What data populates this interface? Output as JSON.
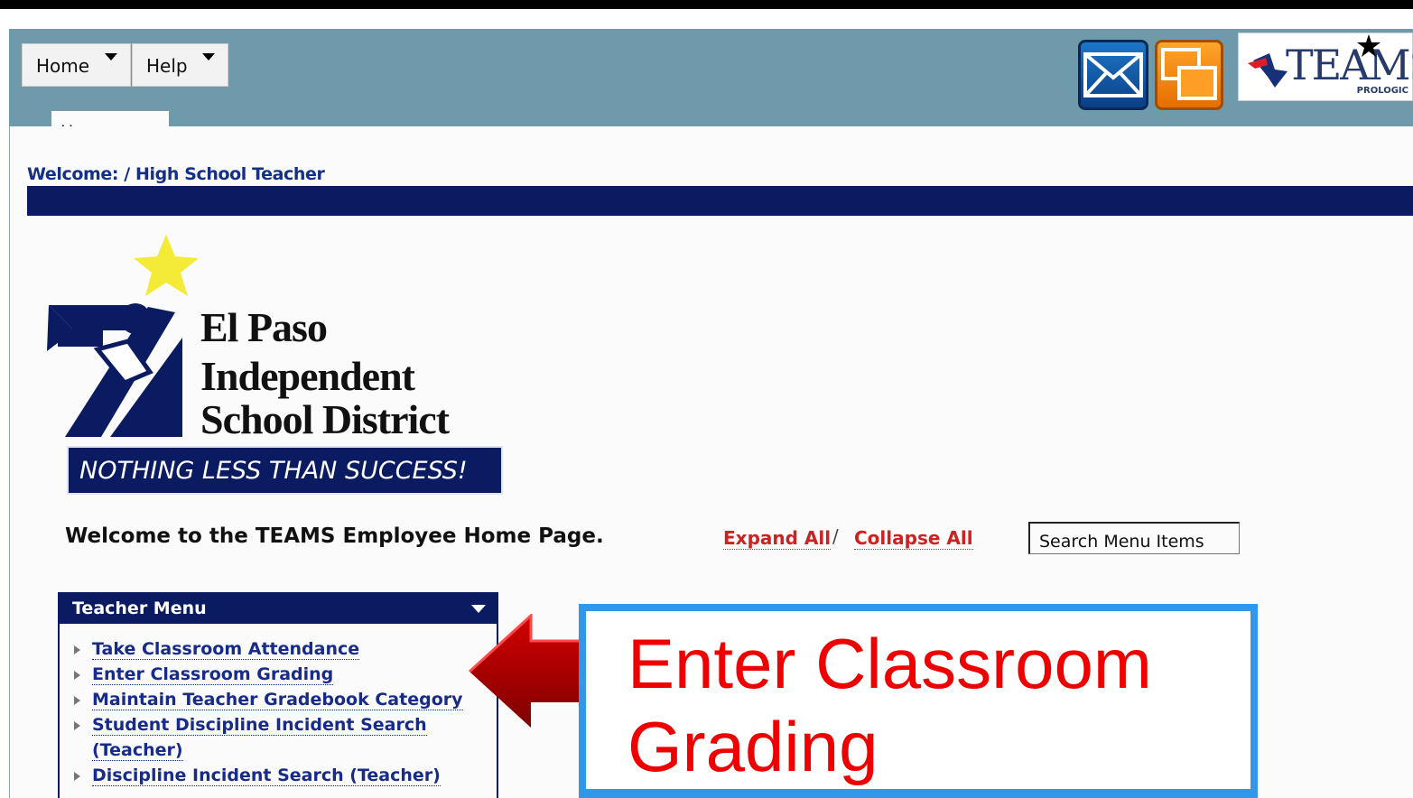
{
  "menubar": {
    "home_label": "Home",
    "help_label": "Help"
  },
  "header": {
    "teams_logo_text": "TEAMS",
    "teams_logo_sub": "PROLOGIC"
  },
  "tabs": [
    {
      "label": "Homepage"
    }
  ],
  "breadcrumb": {
    "text": "Welcome: / High School Teacher"
  },
  "district_logo": {
    "line1": "El Paso",
    "line2": "Independent",
    "line3": "School District",
    "motto": "NOTHING LESS THAN SUCCESS!"
  },
  "home": {
    "welcome_text": "Welcome to the TEAMS Employee Home Page.",
    "expand_all_label": "Expand All",
    "separator": "/",
    "collapse_all_label": "Collapse All",
    "search_value": "Search Menu Items"
  },
  "teacher_menu": {
    "title": "Teacher Menu",
    "items": [
      {
        "label": "Take Classroom Attendance"
      },
      {
        "label": "Enter Classroom Grading"
      },
      {
        "label": "Maintain Teacher Gradebook Category"
      },
      {
        "label": "Student Discipline Incident Search"
      },
      {
        "label": "(Teacher)"
      },
      {
        "label": "Discipline Incident Search (Teacher)"
      }
    ]
  },
  "callout": {
    "line1": "Enter Classroom",
    "line2": "Grading"
  },
  "colors": {
    "navy": "#0b1b62",
    "frame_teal": "#6e9aab",
    "link_blue": "#172c8a",
    "link_red": "#cc2222",
    "callout_red": "#ee0000",
    "callout_border": "#3197e8",
    "arrow_red": "#b00000"
  },
  "icons": {
    "mail": "mail-icon",
    "window": "window-icon",
    "star": "star-icon",
    "arrow": "left-arrow-icon"
  }
}
